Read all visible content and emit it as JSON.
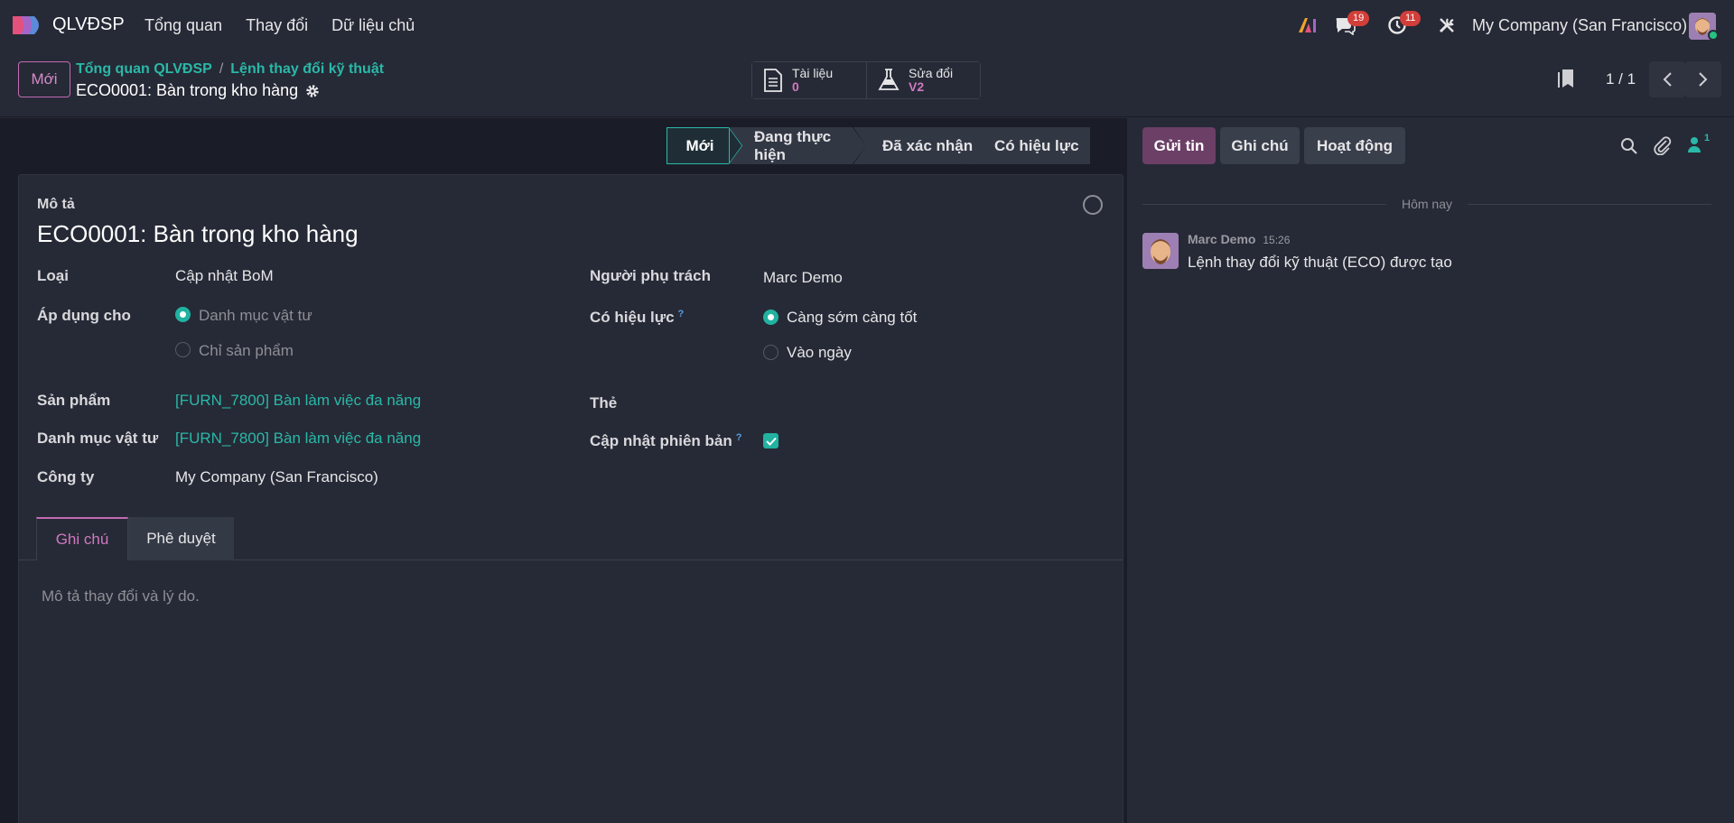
{
  "navbar": {
    "app_name": "QLVĐSP",
    "menu": [
      "Tổng quan",
      "Thay đổi",
      "Dữ liệu chủ"
    ],
    "messages_count": "19",
    "activities_count": "11",
    "company": "My Company (San Francisco)"
  },
  "control": {
    "new_label": "Mới",
    "breadcrumb_1": "Tổng quan QLVĐSP",
    "breadcrumb_sep": "/",
    "breadcrumb_2": "Lệnh thay đổi kỹ thuật",
    "record_name": "ECO0001: Bàn trong kho hàng",
    "smart_docs_label": "Tài liệu",
    "smart_docs_value": "0",
    "smart_rev_label": "Sửa đổi",
    "smart_rev_value": "V2",
    "pager": "1 / 1"
  },
  "status": {
    "stages": [
      "Mới",
      "Đang thực hiện",
      "Đã xác nhận",
      "Có hiệu lực"
    ],
    "active_index": 0
  },
  "form": {
    "desc_label": "Mô tả",
    "title": "ECO0001: Bàn trong kho hàng",
    "type_label": "Loại",
    "type_value": "Cập nhật BoM",
    "apply_label": "Áp dụng cho",
    "apply_opt1": "Danh mục vật tư",
    "apply_opt2": "Chỉ sản phẩm",
    "product_label": "Sản phẩm",
    "product_value": "[FURN_7800] Bàn làm việc đa năng",
    "bom_label": "Danh mục vật tư",
    "bom_value": "[FURN_7800] Bàn làm việc đa năng",
    "company_label": "Công ty",
    "company_value": "My Company (San Francisco)",
    "responsible_label": "Người phụ trách",
    "responsible_value": "Marc Demo",
    "effective_label": "Có hiệu lực",
    "effective_tip": "?",
    "effective_opt1": "Càng sớm càng tốt",
    "effective_opt2": "Vào ngày",
    "tags_label": "Thẻ",
    "version_label": "Cập nhật phiên bản",
    "version_tip": "?",
    "tab_notes": "Ghi chú",
    "tab_approval": "Phê duyệt",
    "notes_placeholder": "Mô tả thay đổi và lý do."
  },
  "chatter": {
    "send_message": "Gửi tin",
    "log_note": "Ghi chú",
    "activities": "Hoạt động",
    "followers_count": "1",
    "date_divider": "Hôm nay",
    "author": "Marc Demo",
    "time": "15:26",
    "message": "Lệnh thay đổi kỹ thuật (ECO) được tạo"
  },
  "colors": {
    "accent_teal": "#2ab8a8",
    "accent_pink": "#c26ab3",
    "badge_red": "#d23f3a"
  }
}
